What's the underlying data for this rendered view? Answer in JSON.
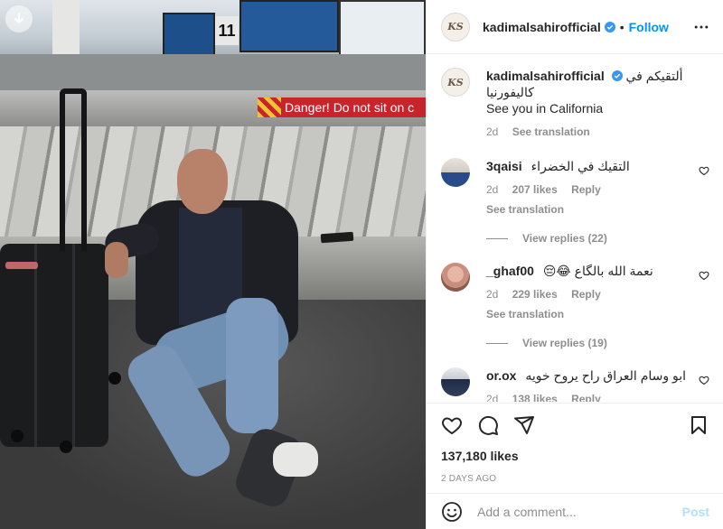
{
  "photo": {
    "alt_sign_text": "Danger! Do not sit on c",
    "gate_number": "11"
  },
  "header": {
    "username": "kadimalsahirofficial",
    "separator": "•",
    "follow_label": "Follow",
    "avatar_monogram": "KS"
  },
  "caption": {
    "username": "kadimalsahirofficial",
    "line1": "ألتقيكم في",
    "line2": "كاليفورنيا",
    "line3": "See you in California",
    "age": "2d",
    "see_translation": "See translation"
  },
  "comments": [
    {
      "username": "3qaisi",
      "text": "التقيك في الخضراء",
      "age": "2d",
      "likes": "207 likes",
      "reply": "Reply",
      "see_translation": "See translation",
      "view_replies": "View replies (22)"
    },
    {
      "username": "_ghaf00",
      "text": "نعمة الله بالگاع 😂😔",
      "age": "2d",
      "likes": "229 likes",
      "reply": "Reply",
      "see_translation": "See translation",
      "view_replies": "View replies (19)"
    },
    {
      "username": "or.ox",
      "text": "ابو وسام العراق راح يروح خويه",
      "age": "2d",
      "likes": "138 likes",
      "reply": "Reply"
    }
  ],
  "actions": {
    "likes": "137,180 likes",
    "date": "2 DAYS AGO"
  },
  "add_comment": {
    "placeholder": "Add a comment...",
    "post_label": "Post"
  },
  "colors": {
    "accent": "#0095f6",
    "muted_text": "#8e8e8e",
    "post_disabled": "#b2dffc"
  },
  "icons": [
    "download-icon",
    "verified-badge-icon",
    "more-options-icon",
    "heart-icon",
    "comment-icon",
    "share-icon",
    "bookmark-icon",
    "emoji-icon"
  ]
}
